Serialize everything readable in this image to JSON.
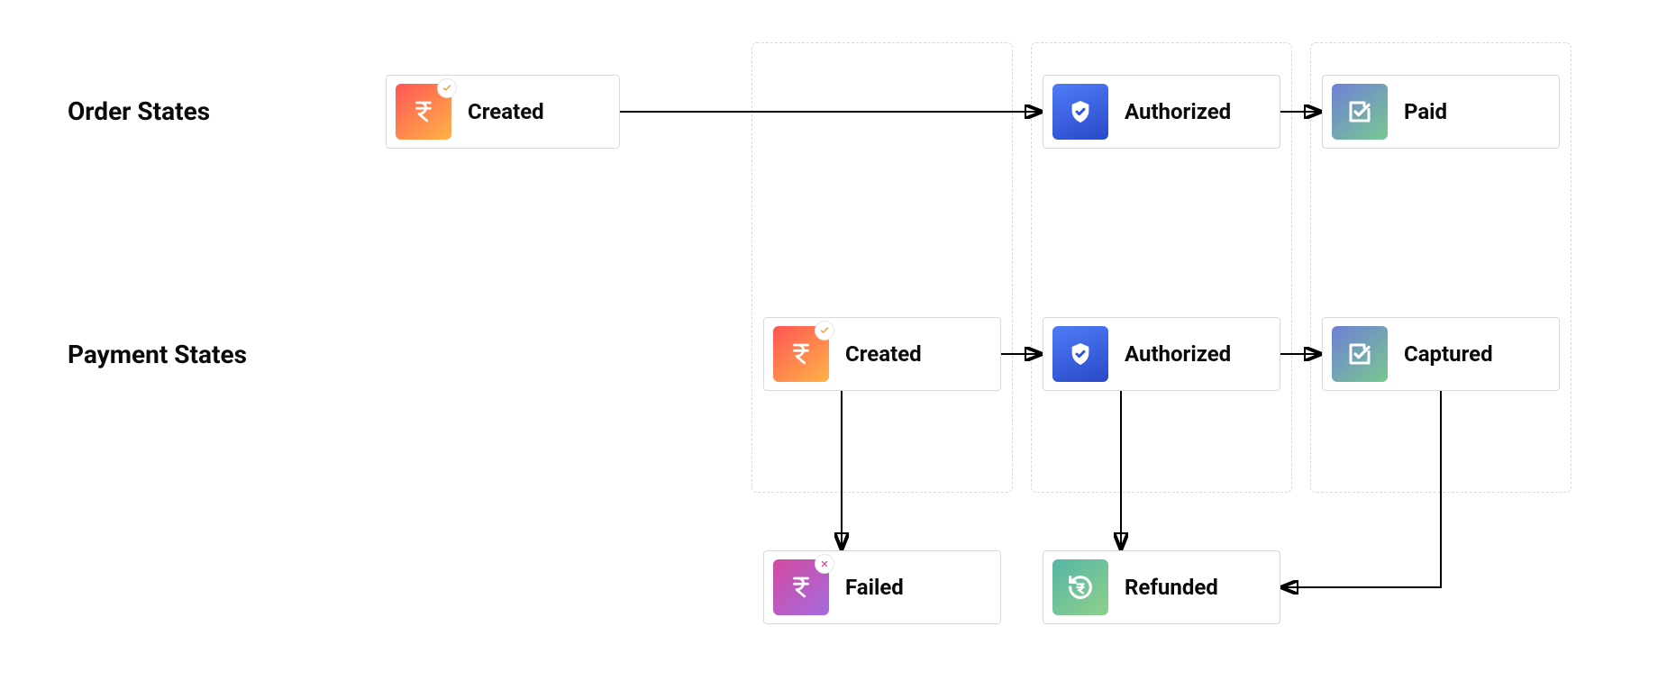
{
  "sections": {
    "order_states_title": "Order States",
    "payment_states_title": "Payment States"
  },
  "order_states": {
    "created": {
      "label": "Created",
      "icon": "rupee-created",
      "gradient": "grad-orange"
    },
    "authorized": {
      "label": "Authorized",
      "icon": "shield-check",
      "gradient": "grad-blue"
    },
    "paid": {
      "label": "Paid",
      "icon": "checkbox",
      "gradient": "grad-green"
    }
  },
  "payment_states": {
    "created": {
      "label": "Created",
      "icon": "rupee-created",
      "gradient": "grad-orange"
    },
    "authorized": {
      "label": "Authorized",
      "icon": "shield-check",
      "gradient": "grad-blue"
    },
    "captured": {
      "label": "Captured",
      "icon": "checkbox",
      "gradient": "grad-green"
    },
    "failed": {
      "label": "Failed",
      "icon": "rupee-failed",
      "gradient": "grad-magenta"
    },
    "refunded": {
      "label": "Refunded",
      "icon": "refund",
      "gradient": "grad-refund"
    }
  },
  "transitions": {
    "order": [
      [
        "created",
        "authorized"
      ],
      [
        "authorized",
        "paid"
      ]
    ],
    "payment": [
      [
        "created",
        "authorized"
      ],
      [
        "authorized",
        "captured"
      ],
      [
        "created",
        "failed"
      ],
      [
        "authorized",
        "refunded"
      ],
      [
        "captured",
        "refunded"
      ]
    ]
  },
  "lanes": [
    "created",
    "authorized",
    "captured/paid"
  ]
}
